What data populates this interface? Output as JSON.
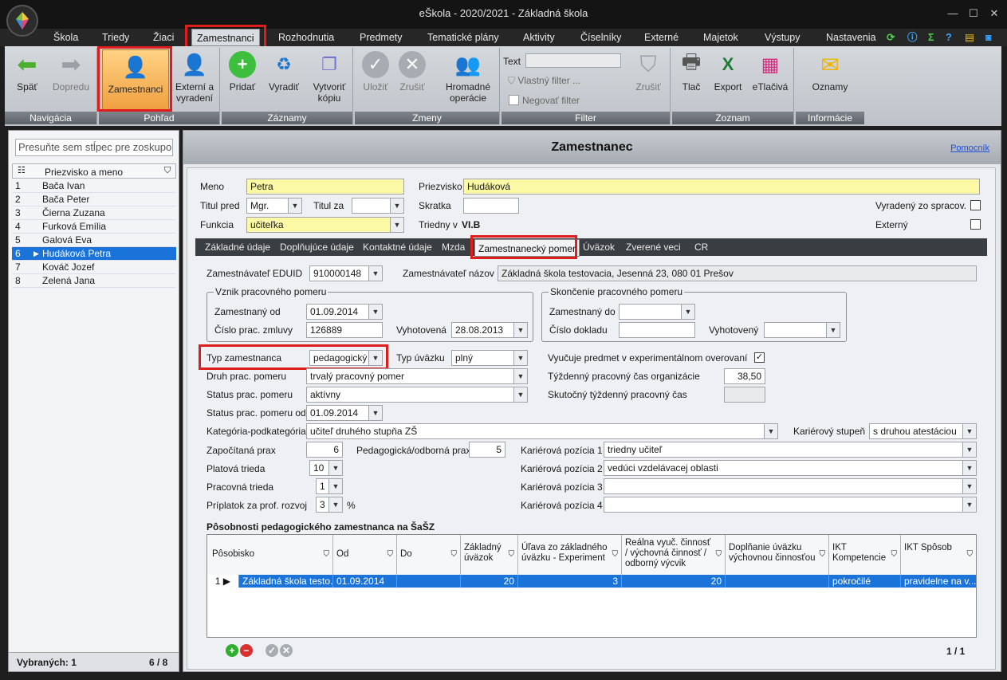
{
  "window": {
    "title": "eŠkola - 2020/2021 - Základná škola",
    "min": "—",
    "max": "☐",
    "close": "✕"
  },
  "menu": [
    "Škola",
    "Triedy",
    "Žiaci",
    "Zamestnanci",
    "Rozhodnutia",
    "Predmety",
    "Tematické plány",
    "Aktivity",
    "Číselníky",
    "Externé",
    "Majetok",
    "Výstupy",
    "Nastavenia"
  ],
  "menu_active": "Zamestnanci",
  "ribbon": {
    "navigacia": {
      "label": "Navigácia",
      "back": "Späť",
      "forward": "Dopredu"
    },
    "pohlad": {
      "label": "Pohľad",
      "employees": "Zamestnanci",
      "external": "Externí a vyradení"
    },
    "zaznamy": {
      "label": "Záznamy",
      "add": "Pridať",
      "discard": "Vyradiť",
      "copy": "Vytvoriť kópiu"
    },
    "zmeny": {
      "label": "Zmeny",
      "save": "Uložiť",
      "cancel": "Zrušiť",
      "bulk": "Hromadné operácie"
    },
    "filter": {
      "label": "Filter",
      "text": "Text",
      "own": "Vlastný filter ...",
      "negate": "Negovať filter",
      "cancel": "Zrušiť"
    },
    "zoznam": {
      "label": "Zoznam",
      "print": "Tlač",
      "export": "Export",
      "etlaciva": "eTlačivá"
    },
    "info": {
      "label": "Informácie",
      "notices": "Oznamy"
    }
  },
  "left": {
    "group_placeholder": "Presuňte sem stĺpec pre zoskupo",
    "col_header": "Priezvisko a meno",
    "rows": [
      {
        "n": "1",
        "name": "Bača Ivan"
      },
      {
        "n": "2",
        "name": "Bača Peter"
      },
      {
        "n": "3",
        "name": "Čierna Zuzana"
      },
      {
        "n": "4",
        "name": "Furková Emília"
      },
      {
        "n": "5",
        "name": "Galová Eva"
      },
      {
        "n": "6",
        "name": "Hudáková Petra"
      },
      {
        "n": "7",
        "name": "Kováč Jozef"
      },
      {
        "n": "8",
        "name": "Zelená Jana"
      }
    ],
    "selected_label": "Vybraných: 1",
    "count": "6 / 8"
  },
  "main": {
    "title": "Zamestnanec",
    "help": "Pomocník",
    "meno_l": "Meno",
    "meno": "Petra",
    "priezvisko_l": "Priezvisko",
    "priezvisko": "Hudáková",
    "titul_pred_l": "Titul pred",
    "titul_pred": "Mgr.",
    "titul_za_l": "Titul za",
    "titul_za": "",
    "skratka_l": "Skratka",
    "skratka": "",
    "vyradeny_l": "Vyradený zo spracov.",
    "funkcia_l": "Funkcia",
    "funkcia": "učiteľka",
    "triedny_l": "Triedny v",
    "triedny": "VI.B",
    "externy_l": "Externý",
    "tabs": [
      "Základné údaje",
      "Doplňujúce údaje",
      "Kontaktné údaje",
      "Mzda",
      "Zamestnanecký pomer",
      "Úväzok",
      "Zverené veci",
      "CR"
    ],
    "tab_active": "Zamestnanecký pomer",
    "edu_id_l": "Zamestnávateľ EDUID",
    "edu_id": "910000148",
    "zam_nazov_l": "Zamestnávateľ názov",
    "zam_nazov": "Základná škola testovacia, Jesenná 23, 080 01 Prešov",
    "vznik": {
      "title": "Vznik pracovného pomeru",
      "od_l": "Zamestnaný od",
      "od": "01.09.2014",
      "zmluva_l": "Číslo prac. zmluvy",
      "zmluva": "126889",
      "vyhot_l": "Vyhotovená",
      "vyhot": "28.08.2013"
    },
    "skoncenie": {
      "title": "Skončenie pracovného pomeru",
      "do_l": "Zamestnaný do",
      "do": "",
      "doklad_l": "Číslo dokladu",
      "doklad": "",
      "vyhot_l": "Vyhotovený",
      "vyhot": ""
    },
    "typ_l": "Typ zamestnanca",
    "typ": "pedagogický",
    "typ_uv_l": "Typ úväzku",
    "typ_uv": "plný",
    "exper_l": "Vyučuje predmet v experimentálnom overovaní",
    "exper_check": "✓",
    "druh_l": "Druh prac. pomeru",
    "druh": "trvalý pracovný pomer",
    "tyzd_l": "Týždenný pracovný čas organizácie",
    "tyzd": "38,50",
    "status_l": "Status prac. pomeru",
    "status": "aktívny",
    "skut_l": "Skutočný týždenný pracovný čas",
    "skut": "",
    "status_od_l": "Status prac. pomeru od",
    "status_od": "01.09.2014",
    "kat_l": "Kategória-podkategória",
    "kat": "učiteľ druhého stupňa ZŠ",
    "kar_st_l": "Kariérový stupeň",
    "kar_st": "s druhou atestáciou",
    "zap_l": "Započítaná prax",
    "zap": "6",
    "ped_l": "Pedagogická/odborná prax",
    "ped": "5",
    "kp1_l": "Kariérová pozícia 1",
    "kp1": "triedny učiteľ",
    "plat_l": "Platová trieda",
    "plat": "10",
    "kp2_l": "Kariérová pozícia 2",
    "kp2": "vedúci vzdelávacej oblasti",
    "prac_l": "Pracovná trieda",
    "prac": "1",
    "kp3_l": "Kariérová pozícia 3",
    "kp3": "",
    "prip_l": "Príplatok za prof. rozvoj",
    "prip": "3",
    "prip_unit": "%",
    "kp4_l": "Kariérová pozícia 4",
    "kp4": "",
    "posob_title": "Pôsobnosti pedagogického zamestnanca na ŠaŠZ",
    "grid_headers": [
      "Pôsobisko",
      "Od",
      "Do",
      "Základný úväzok",
      "Úľava zo základného úväzku - Experiment",
      "Reálna vyuč. činnosť / výchovná činnosť / odborný výcvik",
      "Doplňanie úväzku výchovnou činnosťou",
      "IKT Kompetencie",
      "IKT Spôsob"
    ],
    "grid_row": {
      "n": "1",
      "posobisko": "Základná škola testo...",
      "od": "01.09.2014",
      "do": "",
      "zakl": "20",
      "ulava": "3",
      "realna": "20",
      "doplnanie": "",
      "ikt_k": "pokročilé",
      "ikt_s": "pravidelne na v..."
    },
    "pager": "1 / 1"
  },
  "colors": {
    "accent": "#1a73d8",
    "highlight": "#e01d1d",
    "required": "#fbf8a6"
  }
}
